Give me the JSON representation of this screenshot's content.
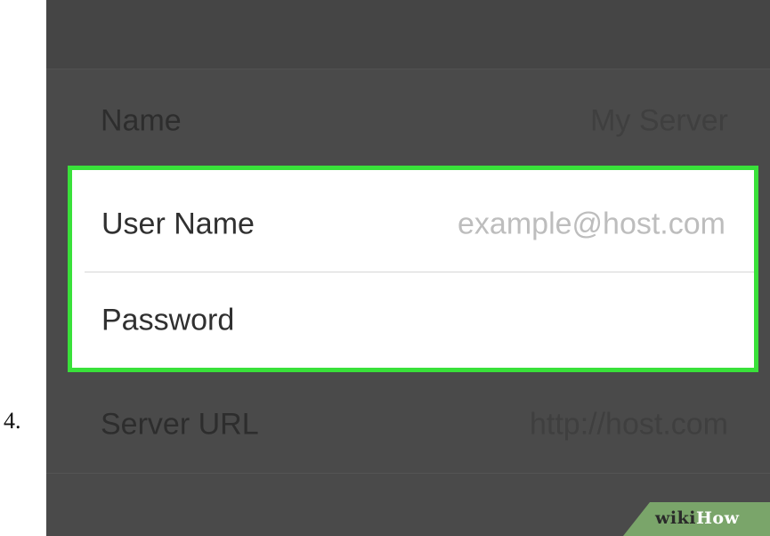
{
  "step": {
    "number": "4."
  },
  "form": {
    "rows": [
      {
        "label": "Name",
        "value": "My Server"
      },
      {
        "label": "User Name",
        "placeholder": "example@host.com"
      },
      {
        "label": "Password",
        "placeholder": ""
      },
      {
        "label": "Server URL",
        "value": "http://host.com"
      }
    ]
  },
  "highlight": {
    "color": "#39e13a"
  },
  "watermark": {
    "wiki": "wiki",
    "how": "How"
  }
}
